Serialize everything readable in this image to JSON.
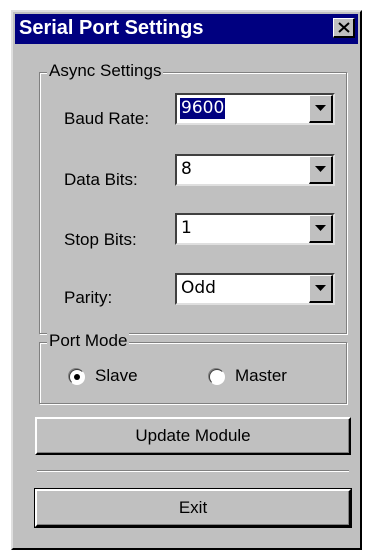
{
  "window": {
    "title": "Serial Port Settings",
    "close_label": "close"
  },
  "async_settings": {
    "legend": "Async Settings",
    "fields": [
      {
        "label": "Baud Rate:",
        "value": "9600"
      },
      {
        "label": "Data Bits:",
        "value": "8"
      },
      {
        "label": "Stop Bits:",
        "value": "1"
      },
      {
        "label": "Parity:",
        "value": "Odd"
      }
    ]
  },
  "port_mode": {
    "legend": "Port Mode",
    "options": [
      {
        "label": "Slave",
        "selected": true
      },
      {
        "label": "Master",
        "selected": false
      }
    ]
  },
  "buttons": {
    "update_label": "Update Module",
    "exit_label": "Exit"
  },
  "colors": {
    "titlebar": "#000080",
    "face": "#c0c0c0",
    "selection": "#000080"
  },
  "icons": {
    "close": "close-x-icon",
    "dropdown": "chevron-down-icon",
    "radio": "radio-icon"
  }
}
